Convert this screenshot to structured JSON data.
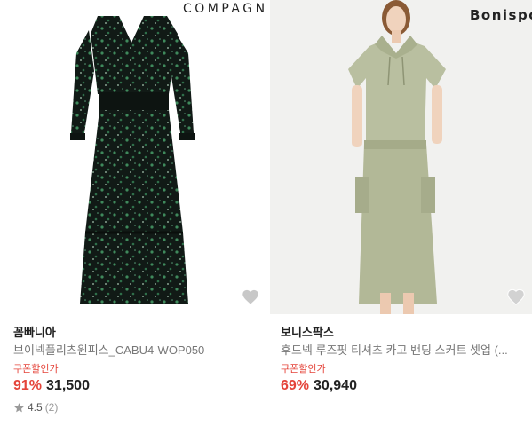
{
  "products": [
    {
      "brand_logo": "COMPAGN",
      "store": "꼼빠니아",
      "title": "브이넥플리츠원피스_CABU4-WOP050",
      "coupon": "쿠폰할인가",
      "discount": "91%",
      "price": "31,500",
      "rating": "4.5",
      "review_count": "(2)",
      "image": "dark-green-floral-dress-photo",
      "wishlist_icon": "heart-icon"
    },
    {
      "brand_logo": "Bonispo",
      "store": "보니스팍스",
      "title": "후드넥 루즈핏 티셔츠 카고 밴딩 스커트 셋업 (...",
      "coupon": "쿠폰할인가",
      "discount": "69%",
      "price": "30,940",
      "image": "sage-hooded-tee-cargo-skirt-photo",
      "wishlist_icon": "heart-icon"
    }
  ],
  "colors": {
    "discount_red": "#e4443a",
    "text_dark": "#222222",
    "text_gray": "#777777",
    "heart_fill": "#c8c8c8"
  }
}
